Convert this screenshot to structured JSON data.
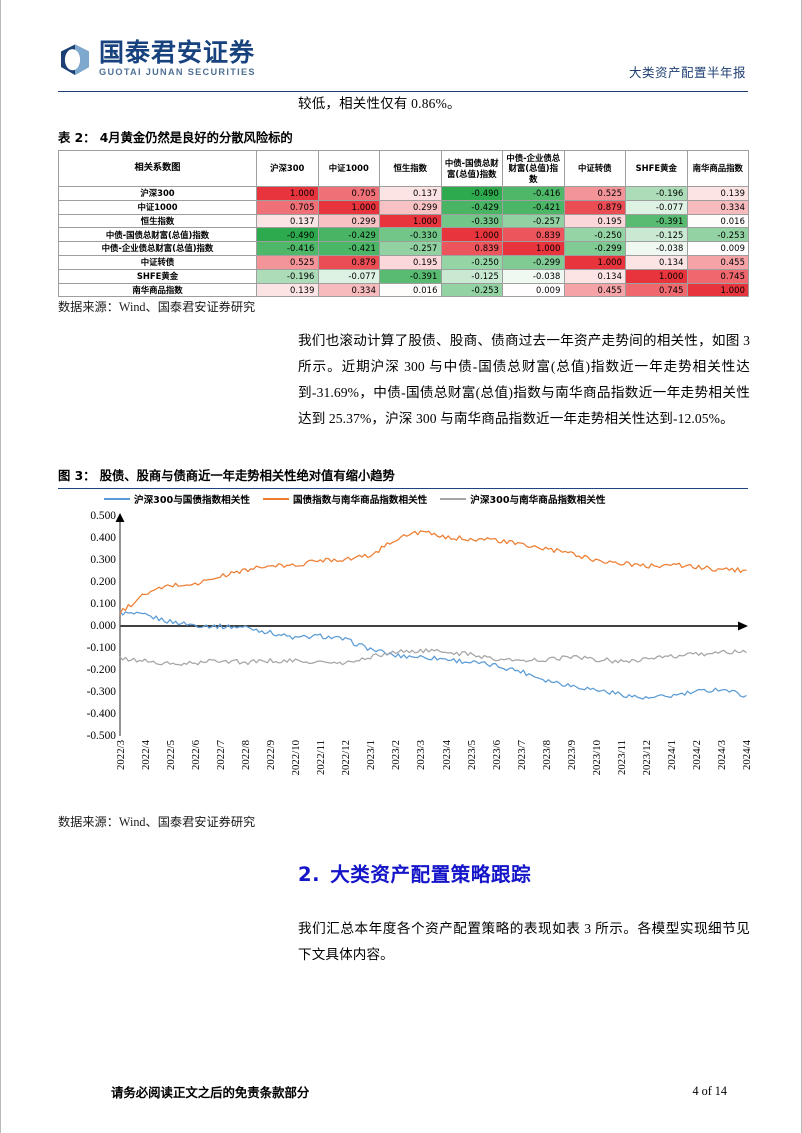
{
  "header": {
    "logo_cn": "国泰君安证券",
    "logo_en": "GUOTAI JUNAN SECURITIES",
    "right_title": "大类资产配置半年报",
    "brand_color": "#17427e"
  },
  "lead_text": "较低，相关性仅有 0.86%。",
  "table": {
    "caption": "表 2： 4月黄金仍然是良好的分散风险标的",
    "source": "数据来源：Wind、国泰君安证券研究",
    "corner_label": "相关系数图",
    "columns": [
      "沪深300",
      "中证1000",
      "恒生指数",
      "中债-国债总财富(总值)指数",
      "中债-企业债总财富(总值)指数",
      "中证转债",
      "SHFE黄金",
      "南华商品指数"
    ],
    "rows": [
      {
        "label": "沪深300",
        "values": [
          1.0,
          0.705,
          0.137,
          -0.49,
          -0.416,
          0.525,
          -0.196,
          0.139
        ]
      },
      {
        "label": "中证1000",
        "values": [
          0.705,
          1.0,
          0.299,
          -0.429,
          -0.421,
          0.879,
          -0.077,
          0.334
        ]
      },
      {
        "label": "恒生指数",
        "values": [
          0.137,
          0.299,
          1.0,
          -0.33,
          -0.257,
          0.195,
          -0.391,
          0.016
        ]
      },
      {
        "label": "中债-国债总财富(总值)指数",
        "values": [
          -0.49,
          -0.429,
          -0.33,
          1.0,
          0.839,
          -0.25,
          -0.125,
          -0.253
        ]
      },
      {
        "label": "中债-企业债总财富(总值)指数",
        "values": [
          -0.416,
          -0.421,
          -0.257,
          0.839,
          1.0,
          -0.299,
          -0.038,
          0.009
        ]
      },
      {
        "label": "中证转债",
        "values": [
          0.525,
          0.879,
          0.195,
          -0.25,
          -0.299,
          1.0,
          0.134,
          0.455
        ]
      },
      {
        "label": "SHFE黄金",
        "values": [
          -0.196,
          -0.077,
          -0.391,
          -0.125,
          -0.038,
          0.134,
          1.0,
          0.745
        ]
      },
      {
        "label": "南华商品指数",
        "values": [
          0.139,
          0.334,
          0.016,
          -0.253,
          0.009,
          0.455,
          0.745,
          1.0
        ]
      }
    ],
    "heat_positive_color": "#e8343c",
    "heat_negative_color": "#2aa84a"
  },
  "paragraph_mid": "我们也滚动计算了股债、股商、债商过去一年资产走势间的相关性，如图 3 所示。近期沪深 300 与中债-国债总财富(总值)指数近一年走势相关性达到-31.69%，中债-国债总财富(总值)指数与南华商品指数近一年走势相关性达到 25.37%，沪深 300 与南华商品指数近一年走势相关性达到-12.05%。",
  "figure": {
    "caption": "图 3： 股债、股商与债商近一年走势相关性绝对值有缩小趋势",
    "source": "数据来源：Wind、国泰君安证券研究"
  },
  "chart_data": {
    "type": "line",
    "title": "股债、股商与债商近一年走势相关性绝对值有缩小趋势",
    "xlabel": "",
    "ylabel": "",
    "ylim": [
      -0.5,
      0.5
    ],
    "yticks": [
      0.5,
      0.4,
      0.3,
      0.2,
      0.1,
      0.0,
      -0.1,
      -0.2,
      -0.3,
      -0.4,
      -0.5
    ],
    "ytick_labels": [
      "0.500",
      "0.400",
      "0.300",
      "0.200",
      "0.100",
      "0.000",
      "-0.100",
      "-0.200",
      "-0.300",
      "-0.400",
      "-0.500"
    ],
    "grid": false,
    "legend_position": "top",
    "x": [
      "2022/3",
      "2022/4",
      "2022/5",
      "2022/6",
      "2022/7",
      "2022/8",
      "2022/9",
      "2022/10",
      "2022/11",
      "2022/12",
      "2023/1",
      "2023/2",
      "2023/3",
      "2023/4",
      "2023/5",
      "2023/6",
      "2023/7",
      "2023/8",
      "2023/9",
      "2023/10",
      "2023/11",
      "2023/12",
      "2024/1",
      "2024/2",
      "2024/3",
      "2024/4"
    ],
    "series": [
      {
        "name": "沪深300与国债指数相关性",
        "color": "#5b9bd5",
        "values": [
          0.06,
          0.048,
          0.02,
          0.004,
          -0.002,
          -0.005,
          -0.03,
          -0.055,
          -0.045,
          -0.062,
          -0.105,
          -0.135,
          -0.14,
          -0.15,
          -0.165,
          -0.18,
          -0.205,
          -0.245,
          -0.27,
          -0.29,
          -0.31,
          -0.33,
          -0.318,
          -0.3,
          -0.285,
          -0.317
        ]
      },
      {
        "name": "国债指数与南华商品指数相关性",
        "color": "#ed7d31",
        "values": [
          0.06,
          0.145,
          0.185,
          0.19,
          0.225,
          0.255,
          0.272,
          0.275,
          0.3,
          0.305,
          0.32,
          0.395,
          0.43,
          0.4,
          0.398,
          0.39,
          0.37,
          0.35,
          0.33,
          0.3,
          0.285,
          0.272,
          0.28,
          0.268,
          0.255,
          0.254
        ]
      },
      {
        "name": "沪深300与南华商品指数相关性",
        "color": "#a5a5a5",
        "values": [
          -0.15,
          -0.158,
          -0.175,
          -0.17,
          -0.155,
          -0.165,
          -0.158,
          -0.16,
          -0.165,
          -0.172,
          -0.14,
          -0.118,
          -0.112,
          -0.118,
          -0.13,
          -0.148,
          -0.16,
          -0.152,
          -0.14,
          -0.152,
          -0.16,
          -0.15,
          -0.14,
          -0.13,
          -0.118,
          -0.12
        ]
      }
    ]
  },
  "section": {
    "number": "2.",
    "title": "大类资产配置策略跟踪",
    "color": "#1414c8"
  },
  "paragraph_last": "我们汇总本年度各个资产配置策略的表现如表 3 所示。各模型实现细节见下文具体内容。",
  "footer": {
    "left": "请务必阅读正文之后的免责条款部分",
    "right": "4 of 14"
  }
}
